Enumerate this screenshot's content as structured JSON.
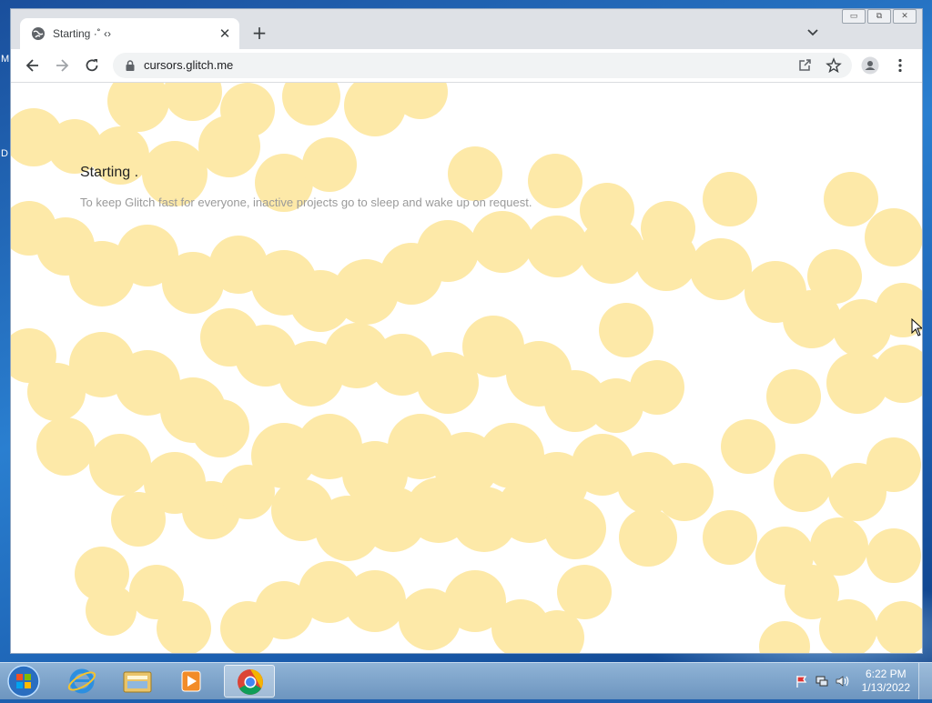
{
  "desktop": {
    "edge_label_1": "M",
    "edge_label_2": "D"
  },
  "browser": {
    "tab": {
      "title": "Starting ·˚ ‹›",
      "favicon": "globe-icon"
    },
    "new_tab_icon": "plus-icon",
    "toolbar": {
      "url": "cursors.glitch.me",
      "back_icon": "back-arrow-icon",
      "forward_icon": "forward-arrow-icon",
      "reload_icon": "reload-icon",
      "share_icon": "share-icon",
      "bookmark_icon": "star-icon",
      "profile_icon": "avatar-icon",
      "menu_icon": "kebab-menu-icon"
    },
    "caption_buttons": {
      "minimize": "▭",
      "restore": "⧉",
      "close": "✕"
    }
  },
  "page": {
    "title": "Starting .",
    "subtitle": "To keep Glitch fast for everyone, inactive projects go to sleep and wake up on request.",
    "blob_color": "#fde9a8"
  },
  "taskbar": {
    "apps": [
      "internet-explorer-icon",
      "file-explorer-icon",
      "media-player-icon",
      "chrome-icon"
    ],
    "clock_time": "6:22 PM",
    "clock_date": "1/13/2022"
  }
}
